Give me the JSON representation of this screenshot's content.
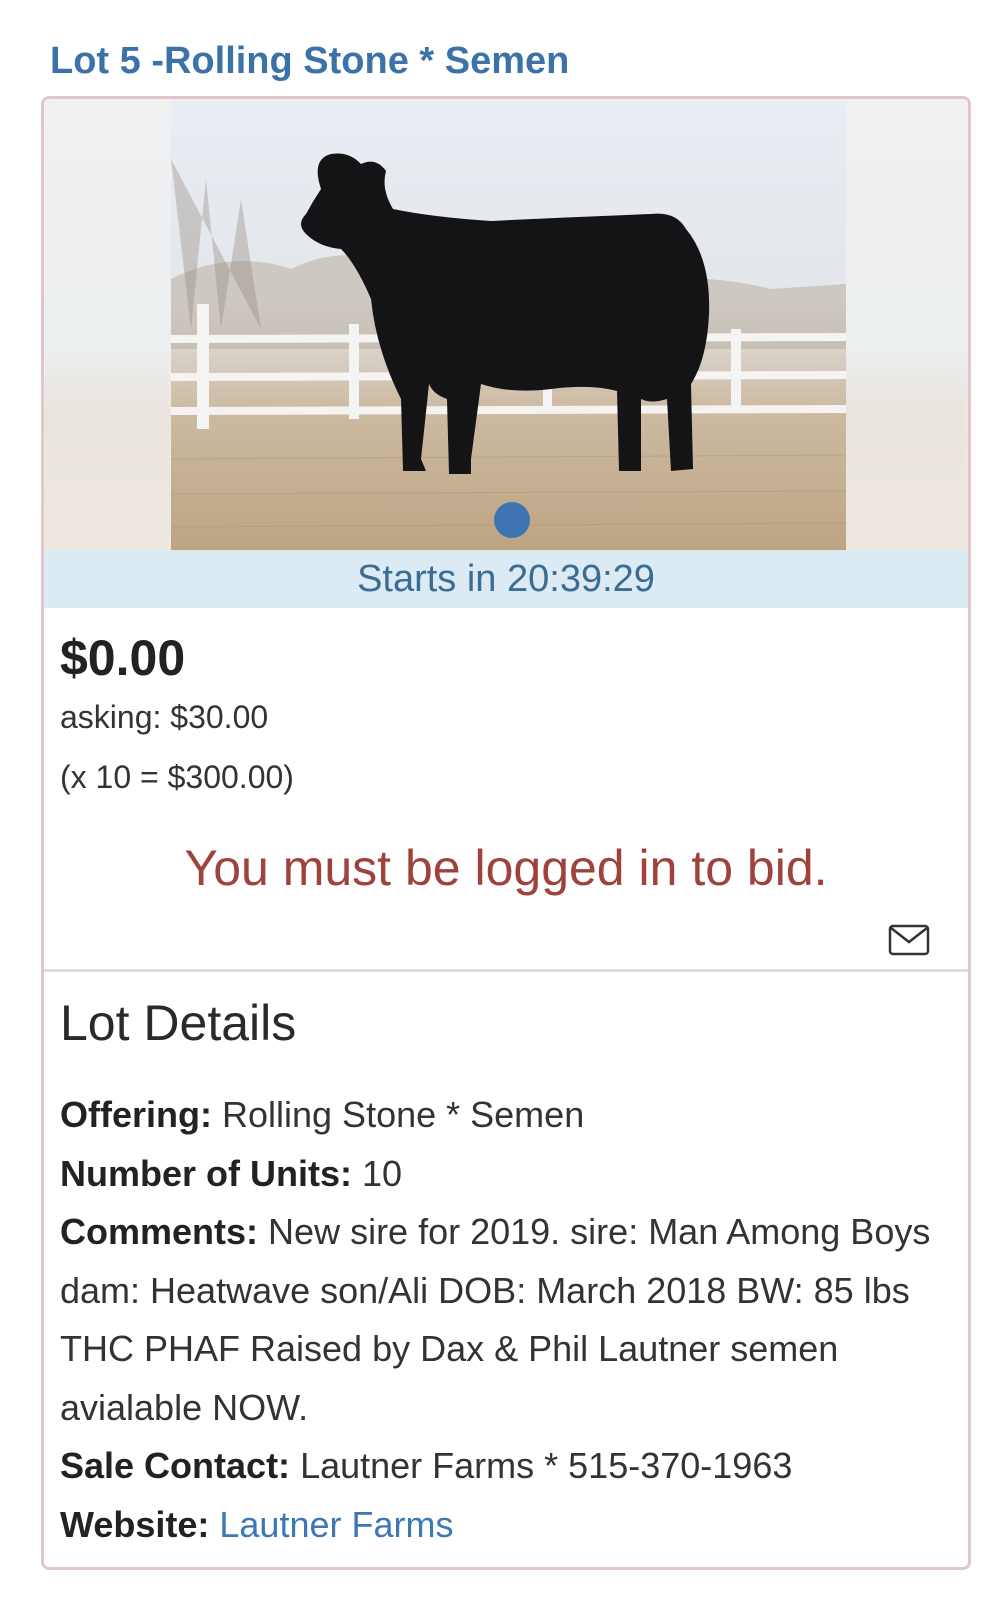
{
  "lot": {
    "title": "Lot 5 -Rolling Stone * Semen"
  },
  "status": {
    "starts_in": "Starts in 20:39:29"
  },
  "bid": {
    "current_price": "$0.00",
    "asking": "asking: $30.00",
    "multiplier": "(x 10 = $300.00)",
    "login_message": "You must be logged in to bid."
  },
  "details": {
    "heading": "Lot Details",
    "offering_label": "Offering:",
    "offering_value": "Rolling Stone * Semen",
    "units_label": "Number of Units:",
    "units_value": "10",
    "comments_label": "Comments:",
    "comments_value": "New sire for 2019. sire: Man Among Boys dam: Heatwave son/Ali DOB: March 2018 BW: 85 lbs THC PHAF Raised by Dax & Phil Lautner semen avialable NOW.",
    "contact_label": "Sale Contact:",
    "contact_value": "Lautner Farms * 515-370-1963",
    "website_label": "Website:",
    "website_value": "Lautner Farms"
  },
  "icons": {
    "mail": "mail-icon",
    "carousel": "carousel-dot-icon"
  },
  "colors": {
    "title": "#3b73a9",
    "status_bar": "#dceaf3",
    "login_message": "#a0413c",
    "link": "#3d77b4"
  }
}
